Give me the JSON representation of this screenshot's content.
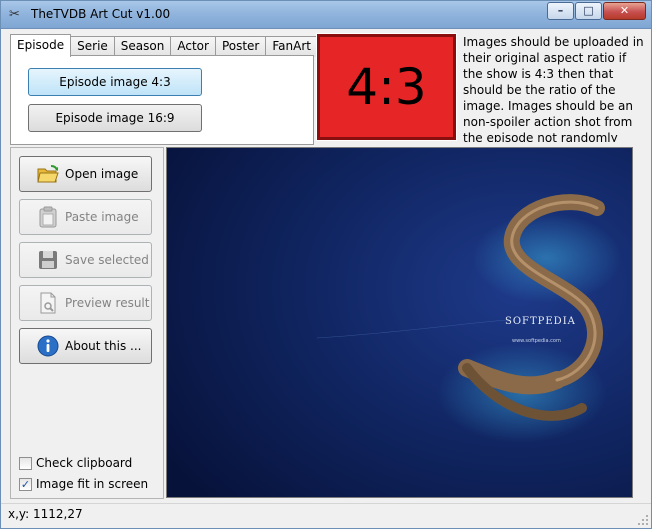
{
  "window": {
    "title": "TheTVDB Art Cut v1.00",
    "app_icon": "scissors-icon",
    "minimize": "–",
    "maximize": "□",
    "close": "✕"
  },
  "tabs": [
    {
      "label": "Episode",
      "active": true
    },
    {
      "label": "Serie",
      "active": false
    },
    {
      "label": "Season",
      "active": false
    },
    {
      "label": "Actor",
      "active": false
    },
    {
      "label": "Poster",
      "active": false
    },
    {
      "label": "FanArt",
      "active": false
    }
  ],
  "episode_panel": {
    "btn_43": "Episode image 4:3",
    "btn_169": "Episode image 16:9"
  },
  "ratio": {
    "label": "4:3",
    "color": "#e62626"
  },
  "info": {
    "text": "Images should be uploaded in their original aspect ratio if the show is 4:3 then that should be the ratio of the image. Images should be an non-spoiler action shot from the episode not randomly generated so we just"
  },
  "actions": {
    "open": {
      "label": "Open image",
      "icon": "folder-open-icon",
      "enabled": true
    },
    "paste": {
      "label": "Paste image",
      "icon": "clipboard-icon",
      "enabled": false
    },
    "save": {
      "label": "Save selected",
      "icon": "floppy-disk-icon",
      "enabled": false
    },
    "preview": {
      "label": "Preview result",
      "icon": "document-preview-icon",
      "enabled": false
    },
    "about": {
      "label": "About this ...",
      "icon": "info-icon",
      "enabled": true
    }
  },
  "options": {
    "check_clipboard": {
      "label": "Check clipboard",
      "checked": false
    },
    "fit_screen": {
      "label": "Image fit in screen",
      "checked": true
    }
  },
  "image": {
    "watermark": "SOFTPEDIA",
    "url_text": "www.softpedia.com"
  },
  "status": {
    "coords": "x,y: 1112,27"
  }
}
